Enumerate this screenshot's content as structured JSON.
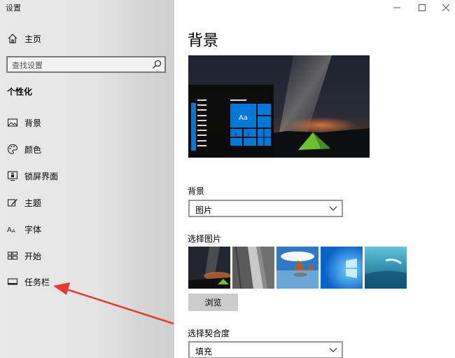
{
  "window": {
    "title": "设置"
  },
  "sidebar": {
    "home_label": "主页",
    "search_placeholder": "查找设置",
    "section_title": "个性化",
    "items": [
      {
        "label": "背景",
        "icon": "picture-icon"
      },
      {
        "label": "颜色",
        "icon": "palette-icon"
      },
      {
        "label": "锁屏界面",
        "icon": "lock-screen-icon"
      },
      {
        "label": "主题",
        "icon": "brush-icon"
      },
      {
        "label": "字体",
        "icon": "font-icon"
      },
      {
        "label": "开始",
        "icon": "start-tiles-icon"
      },
      {
        "label": "任务栏",
        "icon": "taskbar-icon"
      }
    ]
  },
  "main": {
    "page_title": "背景",
    "preview_tile_label": "Aa",
    "background_label": "背景",
    "background_value": "图片",
    "choose_picture_label": "选择图片",
    "browse_label": "浏览",
    "fit_label": "选择契合度",
    "fit_value": "填充"
  },
  "colors": {
    "accent": "#0078d7",
    "arrow": "#e8392e"
  }
}
